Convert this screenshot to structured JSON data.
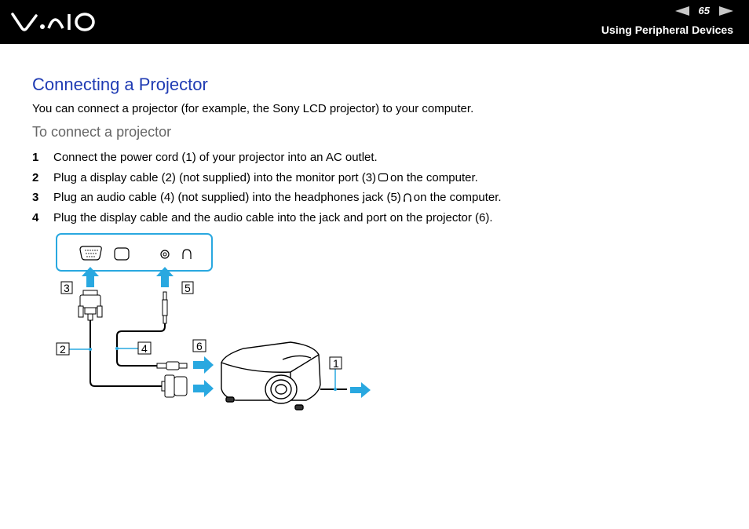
{
  "header": {
    "logo": "VAIO",
    "page_number": "65",
    "section_title": "Using Peripheral Devices",
    "prev_icon": "triangle-left-icon",
    "next_icon": "triangle-right-icon"
  },
  "content": {
    "title": "Connecting a Projector",
    "intro": "You can connect a projector (for example, the Sony LCD projector) to your computer.",
    "subtitle": "To connect a projector",
    "steps": [
      {
        "num": "1",
        "text_before": "Connect the power cord (1) of your projector into an AC outlet.",
        "icon": "",
        "text_after": ""
      },
      {
        "num": "2",
        "text_before": "Plug a display cable (2) (not supplied) into the monitor port (3)",
        "icon": "monitor-icon",
        "text_after": "on the computer."
      },
      {
        "num": "3",
        "text_before": "Plug an audio cable (4) (not supplied) into the headphones jack (5)",
        "icon": "headphones-icon",
        "text_after": "on the computer."
      },
      {
        "num": "4",
        "text_before": "Plug the display cable and the audio cable into the jack and port on the projector (6).",
        "icon": "",
        "text_after": ""
      }
    ]
  },
  "diagram": {
    "callouts": [
      "1",
      "2",
      "3",
      "4",
      "5",
      "6"
    ],
    "accent_color": "#29a8e0"
  }
}
